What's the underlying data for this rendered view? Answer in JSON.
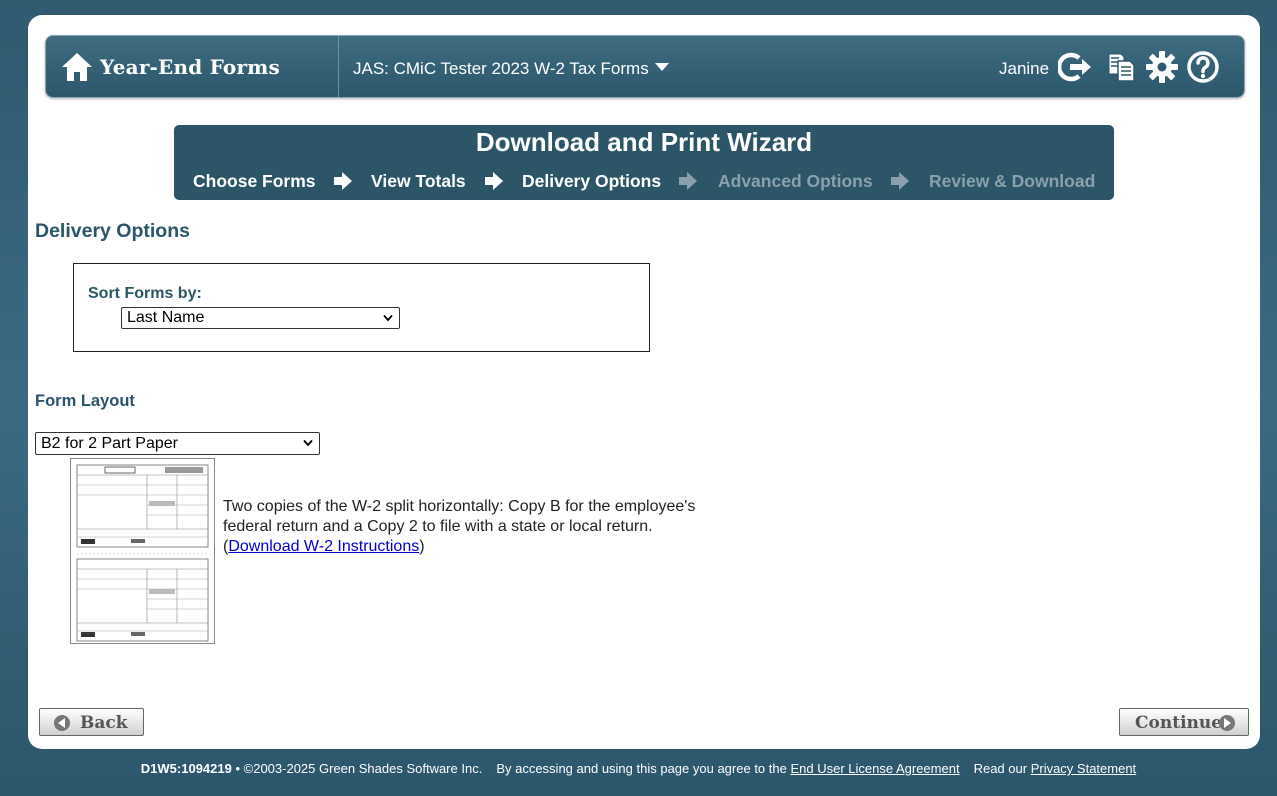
{
  "header": {
    "brand": "Year-End Forms",
    "company": "JAS: CMiC Tester 2023 W-2 Tax Forms",
    "user": "Janine",
    "icons": [
      "home-icon",
      "logout-icon",
      "copy-icon",
      "gear-icon",
      "help-icon"
    ]
  },
  "wizard": {
    "title": "Download and Print Wizard",
    "steps": [
      "Choose Forms",
      "View Totals",
      "Delivery Options",
      "Advanced Options",
      "Review & Download"
    ],
    "active_steps": 3
  },
  "delivery": {
    "title": "Delivery Options",
    "sort_label": "Sort Forms by:",
    "sort_value": "Last Name"
  },
  "layout": {
    "title": "Form Layout",
    "value": "B2 for 2 Part Paper",
    "description": "Two copies of the W-2 split horizontally: Copy B for the employee's federal return and a Copy 2 to file with a state or local return.",
    "link_text": "Download W-2 Instructions",
    "open_paren": "(",
    "close_paren": ")"
  },
  "buttons": {
    "back": "Back",
    "continue": "Continue"
  },
  "footer": {
    "code": "D1W5:1094219",
    "copyright": " • ©2003-2025 Green Shades Software Inc.",
    "agree_text": "By accessing and using this page you agree to the",
    "eula": "End User License Agreement",
    "read_our": "Read our",
    "privacy": "Privacy Statement"
  },
  "colors": {
    "accent": "#2c5568",
    "header": "#3f6c80",
    "dim_step": "#8aa1ad"
  }
}
